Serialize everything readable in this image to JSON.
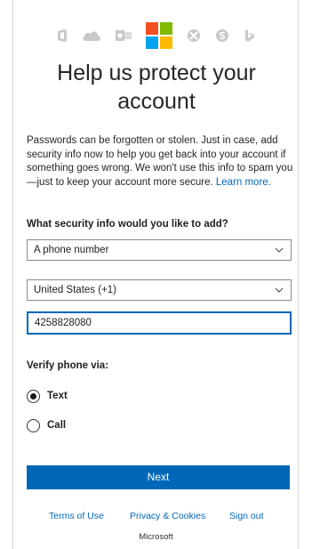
{
  "icons": [
    "office-icon",
    "onedrive-icon",
    "outlook-icon",
    "microsoft-logo-icon",
    "xbox-icon",
    "skype-icon",
    "bing-icon"
  ],
  "colors": {
    "accent": "#0067b8",
    "ms_red": "#f25022",
    "ms_green": "#7fba00",
    "ms_blue": "#00a4ef",
    "ms_yellow": "#ffb900",
    "icon_grey": "#c8c8c8"
  },
  "title": "Help us protect your account",
  "intro": {
    "text": "Passwords can be forgotten or stolen. Just in case, add security info now to help you get back into your account if something goes wrong. We won't use this info to spam you—just to keep your account more secure. ",
    "link": "Learn more."
  },
  "question": "What security info would you like to add?",
  "method_select": {
    "value": "A phone number"
  },
  "country_select": {
    "value": "United States (+1)"
  },
  "phone_input": {
    "value": "4258828080"
  },
  "verify_label": "Verify phone via:",
  "options": [
    {
      "label": "Text",
      "selected": true
    },
    {
      "label": "Call",
      "selected": false
    }
  ],
  "next_button": "Next",
  "footer": {
    "terms": "Terms of Use",
    "privacy": "Privacy & Cookies",
    "signout": "Sign out",
    "brand": "Microsoft"
  }
}
